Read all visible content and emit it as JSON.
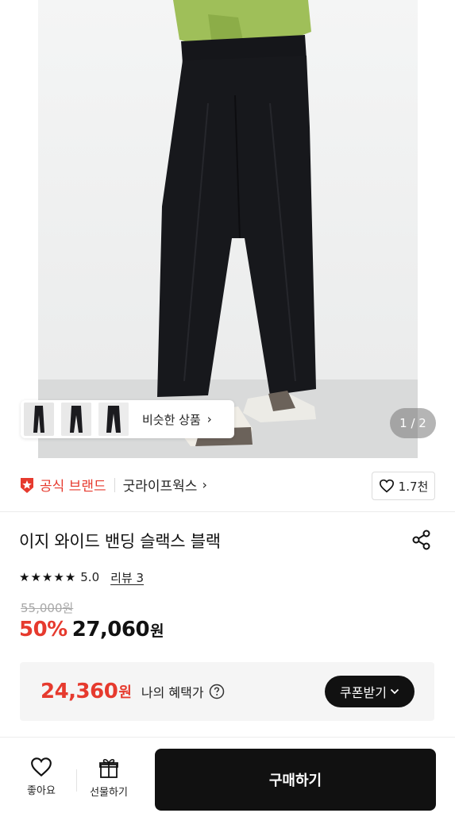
{
  "hero": {
    "page_indicator": "1 / 2",
    "similar_products_label": "비슷한 상품",
    "thumbnails": [
      "thumb-1",
      "thumb-2",
      "thumb-3"
    ]
  },
  "brand": {
    "official_label": "공식 브랜드",
    "name": "굿라이프웍스",
    "like_count": "1.7천"
  },
  "product": {
    "title": "이지 와이드 밴딩 슬랙스 블랙",
    "rating": "5.0",
    "review_label": "리뷰 3",
    "original_price": "55,000원",
    "discount": "50%",
    "sale_price": "27,060",
    "sale_currency": "원"
  },
  "benefit": {
    "price": "24,360",
    "currency": "원",
    "label": "나의 혜택가",
    "coupon_button": "쿠폰받기"
  },
  "bottom_bar": {
    "like_label": "좋아요",
    "gift_label": "선물하기",
    "buy_label": "구매하기"
  },
  "colors": {
    "accent": "#e63a2e",
    "primary_button": "#111111",
    "benefit_bg": "#f5f5f5"
  },
  "icons": [
    "star-badge-icon",
    "heart-icon",
    "share-icon",
    "star-icon",
    "help-icon",
    "chevron-down-icon",
    "gift-icon",
    "chevron-right-icon"
  ]
}
